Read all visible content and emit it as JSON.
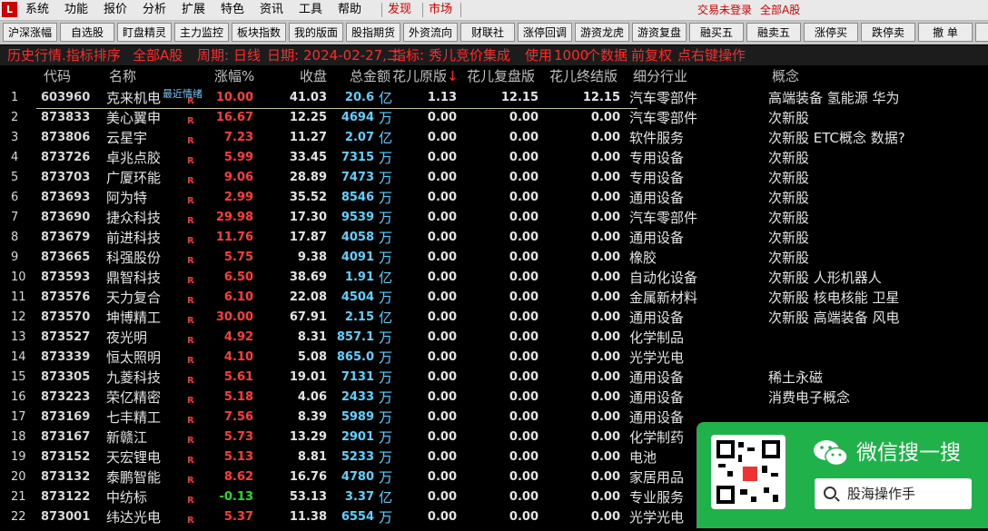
{
  "menu": {
    "items": [
      "系统",
      "功能",
      "报价",
      "分析",
      "扩展",
      "特色",
      "资讯",
      "工具",
      "帮助"
    ],
    "discover": "发现",
    "market": "市场",
    "login": "交易未登录",
    "scope": "全部A股"
  },
  "toolbar": [
    "沪深涨幅",
    "自选股",
    "盯盘精灵",
    "主力监控",
    "板块指数",
    "我的版面",
    "股指期货",
    "外资流向",
    "财联社",
    "涨停回调",
    "游资龙虎",
    "游资复盘",
    "融买五",
    "融卖五",
    "涨停买",
    "跌停卖",
    "撤 单"
  ],
  "status": {
    "title": "历史行情.指标排序",
    "scope": "全部A股",
    "period_label": "周期:",
    "period": "日线",
    "date_label": "日期:",
    "date": "2024-02-27,二",
    "indicator_label": "指标:",
    "indicator": "秀儿竞价集成",
    "usage_a": "使用",
    "usage_count": "1000",
    "usage_b": "个数据",
    "adjust": "前复权",
    "click_hint": "点右键操作"
  },
  "columns": {
    "code": "代码",
    "name": "名称",
    "change": "涨幅%",
    "close": "收盘",
    "amount": "总金额",
    "f1": "花儿原版",
    "f1_sort": "↓",
    "f2": "花儿复盘版",
    "f3": "花儿终结版",
    "industry": "细分行业",
    "concept": "概念"
  },
  "selected_tag": "最近情绪",
  "rows": [
    {
      "no": "1",
      "code": "603960",
      "name": "克来机电",
      "r": "R",
      "change": "10.00",
      "dir": "up",
      "close": "41.03",
      "amount": "20.6",
      "unit": "亿",
      "f1": "1.13",
      "f2": "12.15",
      "f3": "12.15",
      "industry": "汽车零部件",
      "concept": "高端装备 氢能源 华为"
    },
    {
      "no": "2",
      "code": "873833",
      "name": "美心翼申",
      "r": "R",
      "change": "16.67",
      "dir": "up",
      "close": "12.25",
      "amount": "4694",
      "unit": "万",
      "f1": "0.00",
      "f2": "0.00",
      "f3": "0.00",
      "industry": "汽车零部件",
      "concept": "次新股"
    },
    {
      "no": "3",
      "code": "873806",
      "name": "云星宇",
      "r": "R",
      "change": "7.23",
      "dir": "up",
      "close": "11.27",
      "amount": "2.07",
      "unit": "亿",
      "f1": "0.00",
      "f2": "0.00",
      "f3": "0.00",
      "industry": "软件服务",
      "concept": "次新股 ETC概念 数据?"
    },
    {
      "no": "4",
      "code": "873726",
      "name": "卓兆点胶",
      "r": "R",
      "change": "5.99",
      "dir": "up",
      "close": "33.45",
      "amount": "7315",
      "unit": "万",
      "f1": "0.00",
      "f2": "0.00",
      "f3": "0.00",
      "industry": "专用设备",
      "concept": "次新股"
    },
    {
      "no": "5",
      "code": "873703",
      "name": "广厦环能",
      "r": "R",
      "change": "9.06",
      "dir": "up",
      "close": "28.89",
      "amount": "7473",
      "unit": "万",
      "f1": "0.00",
      "f2": "0.00",
      "f3": "0.00",
      "industry": "专用设备",
      "concept": "次新股"
    },
    {
      "no": "6",
      "code": "873693",
      "name": "阿为特",
      "r": "R",
      "change": "2.99",
      "dir": "up",
      "close": "35.52",
      "amount": "8546",
      "unit": "万",
      "f1": "0.00",
      "f2": "0.00",
      "f3": "0.00",
      "industry": "通用设备",
      "concept": "次新股"
    },
    {
      "no": "7",
      "code": "873690",
      "name": "捷众科技",
      "r": "R",
      "change": "29.98",
      "dir": "up",
      "close": "17.30",
      "amount": "9539",
      "unit": "万",
      "f1": "0.00",
      "f2": "0.00",
      "f3": "0.00",
      "industry": "汽车零部件",
      "concept": "次新股"
    },
    {
      "no": "8",
      "code": "873679",
      "name": "前进科技",
      "r": "R",
      "change": "11.76",
      "dir": "up",
      "close": "17.87",
      "amount": "4058",
      "unit": "万",
      "f1": "0.00",
      "f2": "0.00",
      "f3": "0.00",
      "industry": "通用设备",
      "concept": "次新股"
    },
    {
      "no": "9",
      "code": "873665",
      "name": "科强股份",
      "r": "R",
      "change": "5.75",
      "dir": "up",
      "close": "9.38",
      "amount": "4091",
      "unit": "万",
      "f1": "0.00",
      "f2": "0.00",
      "f3": "0.00",
      "industry": "橡胶",
      "concept": "次新股"
    },
    {
      "no": "10",
      "code": "873593",
      "name": "鼎智科技",
      "r": "R",
      "change": "6.50",
      "dir": "up",
      "close": "38.69",
      "amount": "1.91",
      "unit": "亿",
      "f1": "0.00",
      "f2": "0.00",
      "f3": "0.00",
      "industry": "自动化设备",
      "concept": "次新股 人形机器人"
    },
    {
      "no": "11",
      "code": "873576",
      "name": "天力复合",
      "r": "R",
      "change": "6.10",
      "dir": "up",
      "close": "22.08",
      "amount": "4504",
      "unit": "万",
      "f1": "0.00",
      "f2": "0.00",
      "f3": "0.00",
      "industry": "金属新材料",
      "concept": "次新股 核电核能 卫星"
    },
    {
      "no": "12",
      "code": "873570",
      "name": "坤博精工",
      "r": "R",
      "change": "30.00",
      "dir": "up",
      "close": "67.91",
      "amount": "2.15",
      "unit": "亿",
      "f1": "0.00",
      "f2": "0.00",
      "f3": "0.00",
      "industry": "通用设备",
      "concept": "次新股 高端装备 风电"
    },
    {
      "no": "13",
      "code": "873527",
      "name": "夜光明",
      "r": "R",
      "change": "4.92",
      "dir": "up",
      "close": "8.31",
      "amount": "857.1",
      "unit": "万",
      "f1": "0.00",
      "f2": "0.00",
      "f3": "0.00",
      "industry": "化学制品",
      "concept": ""
    },
    {
      "no": "14",
      "code": "873339",
      "name": "恒太照明",
      "r": "R",
      "change": "4.10",
      "dir": "up",
      "close": "5.08",
      "amount": "865.0",
      "unit": "万",
      "f1": "0.00",
      "f2": "0.00",
      "f3": "0.00",
      "industry": "光学光电",
      "concept": ""
    },
    {
      "no": "15",
      "code": "873305",
      "name": "九菱科技",
      "r": "R",
      "change": "5.61",
      "dir": "up",
      "close": "19.01",
      "amount": "7131",
      "unit": "万",
      "f1": "0.00",
      "f2": "0.00",
      "f3": "0.00",
      "industry": "通用设备",
      "concept": "稀土永磁"
    },
    {
      "no": "16",
      "code": "873223",
      "name": "荣亿精密",
      "r": "R",
      "change": "5.18",
      "dir": "up",
      "close": "4.06",
      "amount": "2433",
      "unit": "万",
      "f1": "0.00",
      "f2": "0.00",
      "f3": "0.00",
      "industry": "通用设备",
      "concept": "消费电子概念"
    },
    {
      "no": "17",
      "code": "873169",
      "name": "七丰精工",
      "r": "R",
      "change": "7.56",
      "dir": "up",
      "close": "8.39",
      "amount": "5989",
      "unit": "万",
      "f1": "0.00",
      "f2": "0.00",
      "f3": "0.00",
      "industry": "通用设备",
      "concept": ""
    },
    {
      "no": "18",
      "code": "873167",
      "name": "新赣江",
      "r": "R",
      "change": "5.73",
      "dir": "up",
      "close": "13.29",
      "amount": "2901",
      "unit": "万",
      "f1": "0.00",
      "f2": "0.00",
      "f3": "0.00",
      "industry": "化学制药",
      "concept": ""
    },
    {
      "no": "19",
      "code": "873152",
      "name": "天宏锂电",
      "r": "R",
      "change": "5.13",
      "dir": "up",
      "close": "8.81",
      "amount": "5233",
      "unit": "万",
      "f1": "0.00",
      "f2": "0.00",
      "f3": "0.00",
      "industry": "电池",
      "concept": ""
    },
    {
      "no": "20",
      "code": "873132",
      "name": "泰鹏智能",
      "r": "R",
      "change": "8.62",
      "dir": "up",
      "close": "16.76",
      "amount": "4780",
      "unit": "万",
      "f1": "0.00",
      "f2": "0.00",
      "f3": "0.00",
      "industry": "家居用品",
      "concept": ""
    },
    {
      "no": "21",
      "code": "873122",
      "name": "中纺标",
      "r": "R",
      "change": "-0.13",
      "dir": "dn",
      "close": "53.13",
      "amount": "3.37",
      "unit": "亿",
      "f1": "0.00",
      "f2": "0.00",
      "f3": "0.00",
      "industry": "专业服务",
      "concept": ""
    },
    {
      "no": "22",
      "code": "873001",
      "name": "纬达光电",
      "r": "R",
      "change": "5.37",
      "dir": "up",
      "close": "11.38",
      "amount": "6554",
      "unit": "万",
      "f1": "0.00",
      "f2": "0.00",
      "f3": "0.00",
      "industry": "光学光电",
      "concept": ""
    }
  ],
  "promo": {
    "slogan": "微信搜一搜",
    "search_text": "股海操作手",
    "wechat_icon": "wechat-icon",
    "search_icon": "search-icon"
  }
}
